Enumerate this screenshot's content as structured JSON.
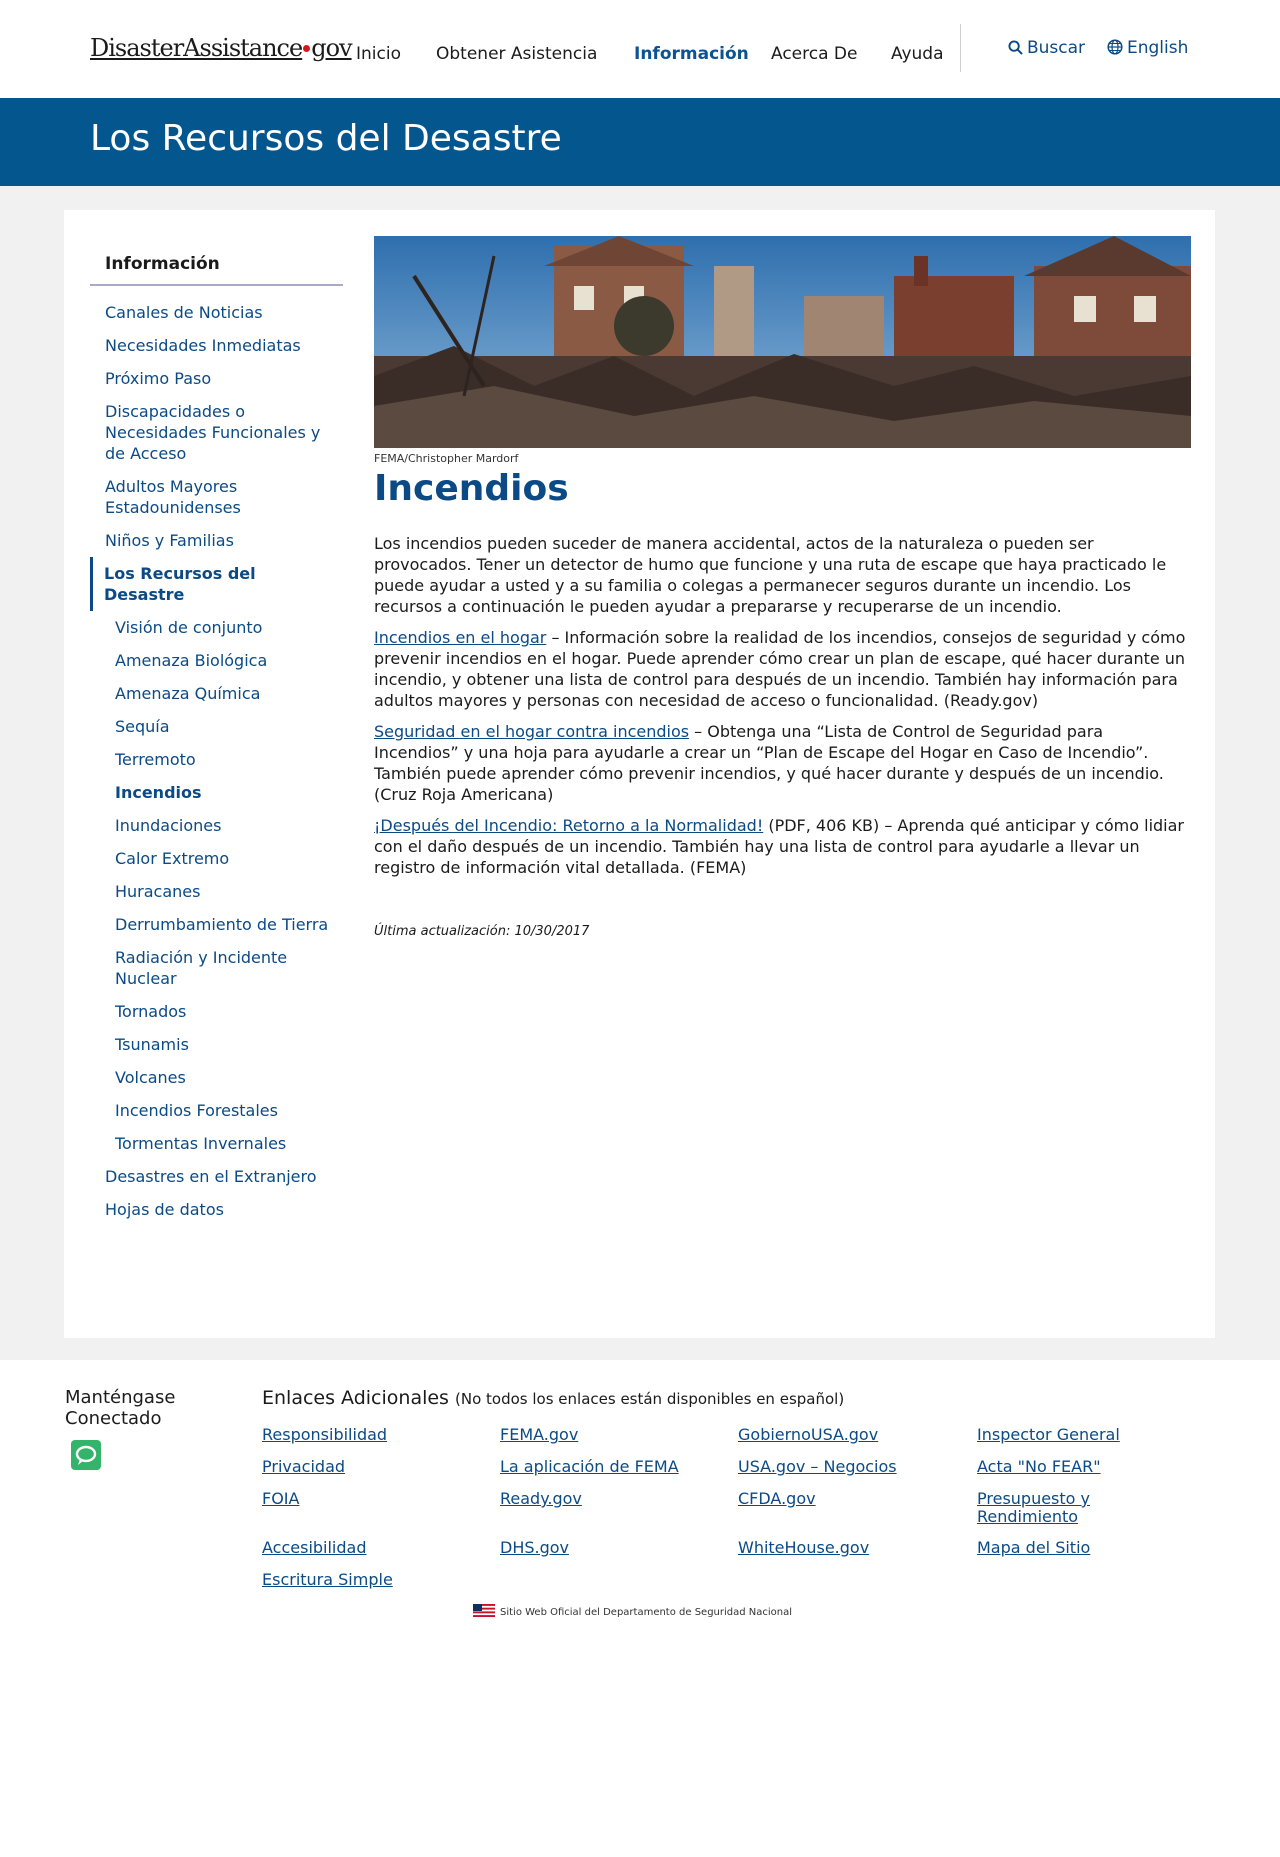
{
  "header": {
    "logo_main": "DisasterAssistance",
    "logo_suffix": "gov",
    "nav": [
      "Inicio",
      "Obtener Asistencia",
      "Información",
      "Acerca De",
      "Ayuda"
    ],
    "search_label": "Buscar",
    "language_label": "English"
  },
  "banner": {
    "title": "Los Recursos del Desastre"
  },
  "sidebar": {
    "heading": "Información",
    "items_top": [
      "Canales de Noticias",
      "Necesidades Inmediatas",
      "Próximo Paso",
      "Discapacidades o Necesidades Funcionales y de Acceso",
      "Adultos Mayores Estadounidenses",
      "Niños y Familias"
    ],
    "current": "Los Recursos del Desastre",
    "sub_items": [
      "Visión de conjunto",
      "Amenaza Biológica",
      "Amenaza Química",
      "Sequía",
      "Terremoto",
      "Incendios",
      "Inundaciones",
      "Calor Extremo",
      "Huracanes",
      "Derrumbamiento de Tierra",
      "Radiación y Incidente Nuclear",
      "Tornados",
      "Tsunamis",
      "Volcanes",
      "Incendios Forestales",
      "Tormentas Invernales"
    ],
    "items_bottom": [
      "Desastres en el Extranjero",
      "Hojas de datos"
    ]
  },
  "content": {
    "image_caption": "FEMA/Christopher Mardorf",
    "title": "Incendios",
    "intro": "Los incendios pueden suceder de manera accidental, actos de la naturaleza o pueden ser provocados. Tener un detector de humo que funcione y una ruta de escape que haya practicado le puede ayudar a usted y a su familia o colegas a permanecer seguros durante un incendio. Los recursos a continuación le pueden ayudar a prepararse y recuperarse de un incendio.",
    "resources": [
      {
        "link": "Incendios en el hogar",
        "text": " – Información sobre la realidad de los incendios, consejos de seguridad y cómo prevenir incendios en el hogar. Puede aprender cómo crear un plan de escape, qué hacer durante un incendio, y obtener una lista de control para después de un incendio. También hay información para adultos mayores y personas con necesidad de acceso o funcionalidad. (Ready.gov)"
      },
      {
        "link": "Seguridad en el hogar contra incendios",
        "text": " – Obtenga una “Lista de Control de Seguridad para Incendios” y una hoja para ayudarle a crear un “Plan de Escape del Hogar en Caso de Incendio”. También puede aprender cómo prevenir incendios, y qué hacer durante y después de un incendio. (Cruz Roja Americana)"
      },
      {
        "link": "¡Después del Incendio: Retorno a la Normalidad!",
        "text": " (PDF, 406 KB) – Aprenda qué anticipar y cómo lidiar con el daño después de un incendio. También hay una lista de control para ayudarle a llevar un registro de información vital detallada. (FEMA)"
      }
    ],
    "last_updated": "Última actualización: 10/30/2017"
  },
  "footer": {
    "stay_connected": "Manténgase Conectado",
    "links_title": "Enlaces Adicionales",
    "links_note": "(No todos los enlaces están disponibles en español)",
    "links": [
      "Responsibilidad",
      "FEMA.gov",
      "GobiernoUSA.gov",
      "Inspector General",
      "Privacidad",
      "La aplicación de FEMA",
      "USA.gov – Negocios",
      "Acta \"No FEAR\"",
      "FOIA",
      "Ready.gov",
      "CFDA.gov",
      "Presupuesto y Rendimiento",
      "Accesibilidad",
      "DHS.gov",
      "WhiteHouse.gov",
      "Mapa del Sitio",
      "Escritura Simple"
    ],
    "official_note": "Sitio Web Oficial del Departamento de Seguridad Nacional"
  },
  "icons": {
    "search": "search-icon",
    "language": "globe-icon",
    "chat": "chat-icon",
    "flag": "us-flag-icon"
  },
  "colors": {
    "brand_blue": "#04568f",
    "link": "#0b4a85",
    "logo_dot": "#d3191c",
    "chat": "#34b36b"
  }
}
